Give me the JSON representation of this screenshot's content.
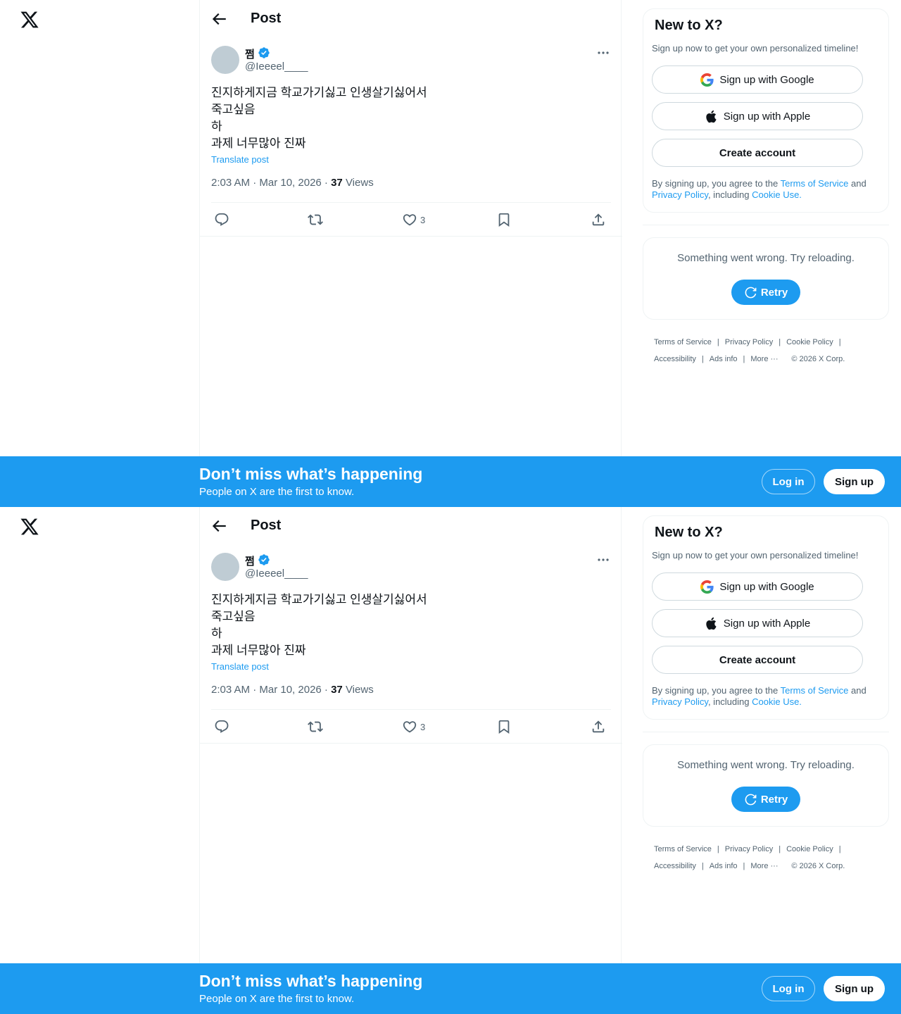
{
  "header": {
    "title": "Post"
  },
  "post": {
    "display_name": "쩜",
    "handle": "@Ieeeel____",
    "text": "진지하게지금 학교가기싫고 인생살기싫어서\n죽고싶음\n하\n과제 너무많아 진짜",
    "translate_label": "Translate post",
    "time": "2:03 AM · Mar 10, 2026 · ",
    "views_count": "37",
    "views_label": " Views",
    "like_count": "3"
  },
  "signup_card": {
    "title": "New to X?",
    "subtitle": "Sign up now to get your own personalized timeline!",
    "google_label": "Sign up with Google",
    "apple_label": "Sign up with Apple",
    "create_label": "Create account",
    "terms_prefix": "By signing up, you agree to the ",
    "terms_link": "Terms of Service",
    "terms_and": " and ",
    "privacy_link": "Privacy Policy",
    "terms_including": ", including ",
    "cookie_link": "Cookie Use."
  },
  "error_card": {
    "message": "Something went wrong. Try reloading.",
    "retry_label": "Retry"
  },
  "footer": {
    "terms": "Terms of Service",
    "privacy": "Privacy Policy",
    "cookie": "Cookie Policy",
    "accessibility": "Accessibility",
    "ads": "Ads info",
    "more": "More ···",
    "copyright": "© 2026 X Corp."
  },
  "banner": {
    "title": "Don’t miss what’s happening",
    "subtitle": "People on X are the first to know.",
    "login_label": "Log in",
    "signup_label": "Sign up"
  },
  "colors": {
    "accent": "#1d9bf0",
    "muted": "#536471",
    "border": "#eff3f4"
  },
  "icons": [
    "x-logo-icon",
    "back-arrow-icon",
    "verified-badge-icon",
    "more-icon",
    "reply-icon",
    "repost-icon",
    "like-icon",
    "bookmark-icon",
    "share-icon",
    "google-icon",
    "apple-icon",
    "refresh-icon"
  ]
}
